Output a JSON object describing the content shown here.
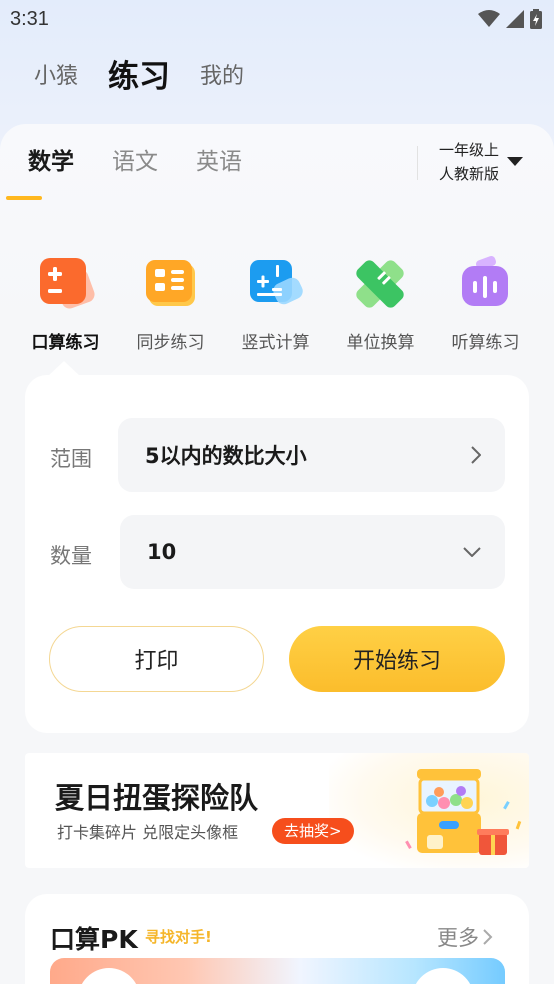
{
  "status_bar": {
    "time": "3:31"
  },
  "top_nav": {
    "tabs": [
      "小猿",
      "练习",
      "我的"
    ],
    "active_index": 1
  },
  "subject_tabs": {
    "tabs": [
      "数学",
      "语文",
      "英语"
    ],
    "active_index": 0
  },
  "grade": {
    "line1": "一年级上",
    "line2": "人教新版"
  },
  "tools": [
    {
      "label": "口算练习",
      "icon": "calculator-icon"
    },
    {
      "label": "同步练习",
      "icon": "book-sync-icon"
    },
    {
      "label": "竖式计算",
      "icon": "vertical-calc-icon"
    },
    {
      "label": "单位换算",
      "icon": "ruler-icon"
    },
    {
      "label": "听算练习",
      "icon": "audio-wave-icon"
    }
  ],
  "active_tool_index": 0,
  "form": {
    "range_label": "范围",
    "range_value": "5以内的数比大小",
    "count_label": "数量",
    "count_value": "10",
    "print_button": "打印",
    "start_button": "开始练习"
  },
  "banner": {
    "title": "夏日扭蛋探险队",
    "subtitle": "打卡集碎片 兑限定头像框",
    "badge": "去抽奖>"
  },
  "pk": {
    "title": "口算PK",
    "subtitle": "寻找对手!",
    "more": "更多"
  },
  "colors": {
    "accent": "#ffb81f",
    "start_button": "#fcc22f",
    "badge": "#f64e1c"
  }
}
